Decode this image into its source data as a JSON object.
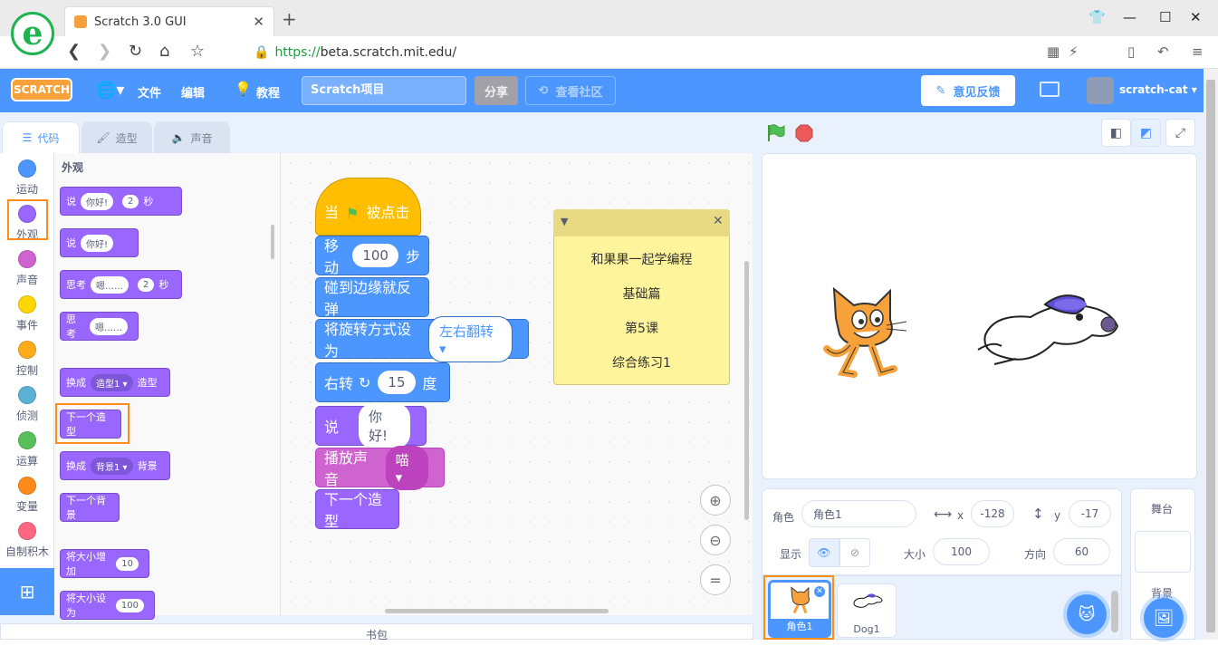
{
  "browser": {
    "tab_title": "Scratch 3.0 GUI",
    "url_https": "https://",
    "url_host": "beta.scratch.mit.edu",
    "url_path": "/"
  },
  "menubar": {
    "logo_text": "SCRATCH",
    "file": "文件",
    "edit": "编辑",
    "tutorials": "教程",
    "project_title": "Scratch项目",
    "share": "分享",
    "see_community": "查看社区",
    "feedback": "意见反馈",
    "username": "scratch-cat"
  },
  "tabs": {
    "code": "代码",
    "costumes": "造型",
    "sounds": "声音"
  },
  "categories": [
    {
      "label": "运动",
      "color": "#4c97ff"
    },
    {
      "label": "外观",
      "color": "#9966ff"
    },
    {
      "label": "声音",
      "color": "#cf63cf"
    },
    {
      "label": "事件",
      "color": "#ffd500"
    },
    {
      "label": "控制",
      "color": "#ffab19"
    },
    {
      "label": "侦测",
      "color": "#5cb1d6"
    },
    {
      "label": "运算",
      "color": "#59c059"
    },
    {
      "label": "变量",
      "color": "#ff8c1a"
    },
    {
      "label": "自制积木",
      "color": "#ff6680"
    }
  ],
  "palette": {
    "heading": "外观",
    "b1": {
      "say": "说",
      "msg": "你好!",
      "secs": "2",
      "unit": "秒"
    },
    "b2": {
      "say": "说",
      "msg": "你好!"
    },
    "b3": {
      "think": "思考",
      "msg": "嗯……",
      "secs": "2",
      "unit": "秒"
    },
    "b4": {
      "think": "思考",
      "msg": "嗯……"
    },
    "b5": {
      "switch": "换成",
      "costume": "造型1",
      "suffix": "造型"
    },
    "b6": "下一个造型",
    "b7": {
      "switch": "换成",
      "backdrop": "背景1",
      "suffix": "背景"
    },
    "b8": "下一个背景",
    "b9": {
      "label": "将大小增加",
      "val": "10"
    },
    "b10": {
      "label": "将大小设为",
      "val": "100"
    }
  },
  "script": {
    "hat_when": "当",
    "hat_clicked": "被点击",
    "move": "移动",
    "move_val": "100",
    "move_unit": "步",
    "bounce": "碰到边缘就反弹",
    "rot_style": "将旋转方式设为",
    "rot_val": "左右翻转",
    "turn": "右转",
    "turn_val": "15",
    "turn_unit": "度",
    "say": "说",
    "say_val": "你好!",
    "play": "播放声音",
    "play_val": "喵",
    "next_costume": "下一个造型"
  },
  "note": {
    "l1": "和果果一起学编程",
    "l2": "基础篇",
    "l3": "第5课",
    "l4": "综合练习1"
  },
  "backpack": "书包",
  "sprite_info": {
    "sprite_label": "角色",
    "sprite_name": "角色1",
    "x_label": "x",
    "x": "-128",
    "y_label": "y",
    "y": "-17",
    "show_label": "显示",
    "size_label": "大小",
    "size": "100",
    "direction_label": "方向",
    "direction": "60"
  },
  "sprites": [
    {
      "name": "角色1"
    },
    {
      "name": "Dog1"
    }
  ],
  "stage_panel": {
    "title": "舞台",
    "backdrops": "背景"
  }
}
